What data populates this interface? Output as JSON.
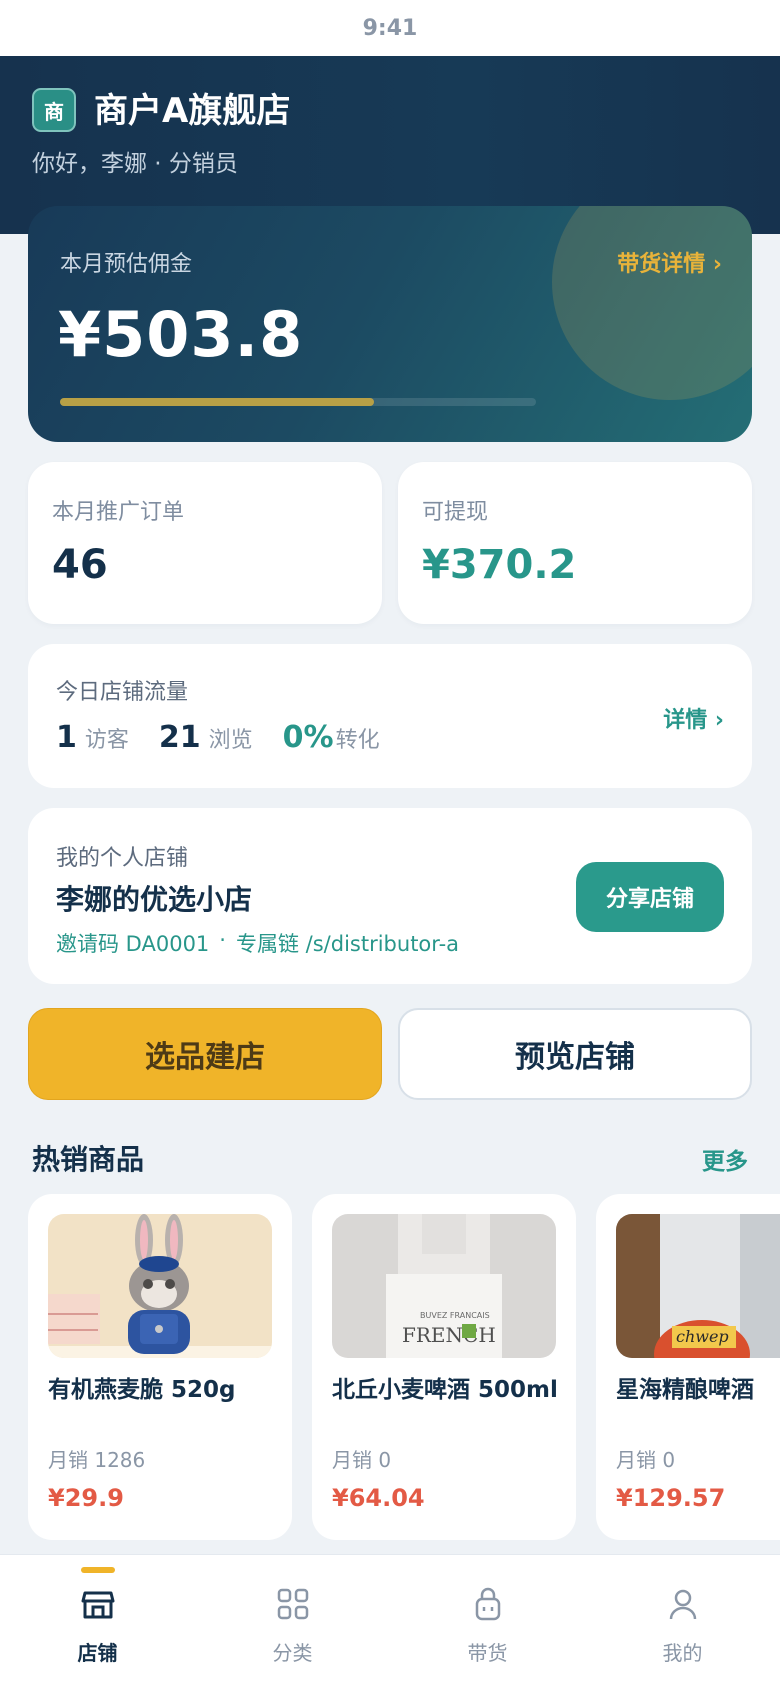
{
  "status_bar": {
    "time": "9:41"
  },
  "header": {
    "store_badge": "商",
    "store_name": "商户A旗舰店",
    "greeting": "你好，李娜 · 分销员"
  },
  "commission": {
    "label": "本月预估佣金",
    "link": "带货详情 ›",
    "amount": "¥503.8",
    "progress": 0.66
  },
  "stats": [
    {
      "label": "本月推广订单",
      "value": "46"
    },
    {
      "label": "可提现",
      "value": "¥370.2"
    }
  ],
  "traffic": {
    "title": "今日店铺流量",
    "visitors_value": "1",
    "visitors_unit": "访客",
    "views_value": "21",
    "views_unit": "浏览",
    "conversion_value": "0%",
    "conversion_unit": "转化",
    "link": "详情 ›"
  },
  "personal_store": {
    "label": "我的个人店铺",
    "name": "李娜的优选小店",
    "invite": "邀请码 DA0001",
    "separator": "·",
    "link": "专属链 /s/distributor-a",
    "share_button": "分享店铺"
  },
  "actions": {
    "select_build": "选品建店",
    "preview": "预览店铺"
  },
  "hot_products": {
    "title": "热销商品",
    "more": "更多",
    "items": [
      {
        "name": "有机燕麦脆 520g",
        "sales": "月销 1286",
        "price": "¥29.9"
      },
      {
        "name": "北丘小麦啤酒 500ml",
        "sales": "月销 0",
        "price": "¥64.04"
      },
      {
        "name": "星海精酿啤酒",
        "sales": "月销 0",
        "price": "¥129.57"
      }
    ]
  },
  "tabbar": {
    "tabs": [
      {
        "label": "店铺",
        "icon": "store-icon",
        "active": true
      },
      {
        "label": "分类",
        "icon": "grid-icon",
        "active": false
      },
      {
        "label": "带货",
        "icon": "bag-icon",
        "active": false
      },
      {
        "label": "我的",
        "icon": "user-icon",
        "active": false
      }
    ]
  },
  "colors": {
    "header_bg": "#16324e",
    "accent_green": "#28968a",
    "accent_yellow": "#f0b429",
    "price_red": "#e35a45"
  }
}
